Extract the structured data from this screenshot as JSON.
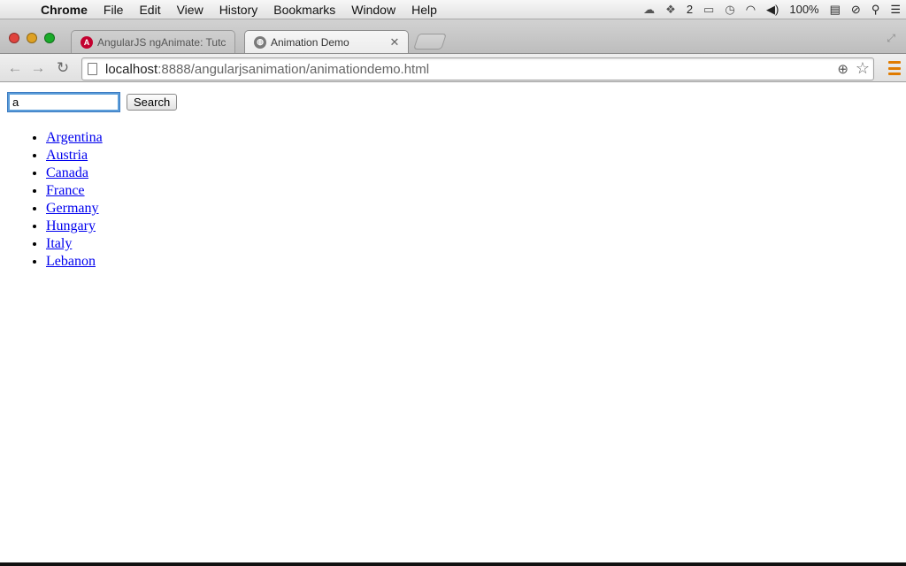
{
  "menubar": {
    "app_name": "Chrome",
    "items": [
      "File",
      "Edit",
      "View",
      "History",
      "Bookmarks",
      "Window",
      "Help"
    ],
    "status": {
      "notification_count": "2",
      "battery": "100%"
    }
  },
  "tabs": [
    {
      "title": "AngularJS ngAnimate: Tutc",
      "favicon": "A",
      "active": false
    },
    {
      "title": "Animation Demo",
      "favicon": "",
      "active": true
    }
  ],
  "address_bar": {
    "host": "localhost",
    "path": ":8888/angularjsanimation/animationdemo.html"
  },
  "search": {
    "value": "a",
    "button_label": "Search"
  },
  "countries": [
    "Argentina",
    "Austria",
    "Canada",
    "France",
    "Germany",
    "Hungary",
    "Italy",
    "Lebanon"
  ],
  "icons": {
    "apple": "apple-logo-icon",
    "page": "page-icon",
    "zoom": "zoom-icon",
    "star": "bookmark-star-icon",
    "menu": "chrome-menu-icon"
  },
  "colors": {
    "link": "#0000ee",
    "focus_ring": "#5b9dd9",
    "menu_accent": "#e07b00"
  }
}
